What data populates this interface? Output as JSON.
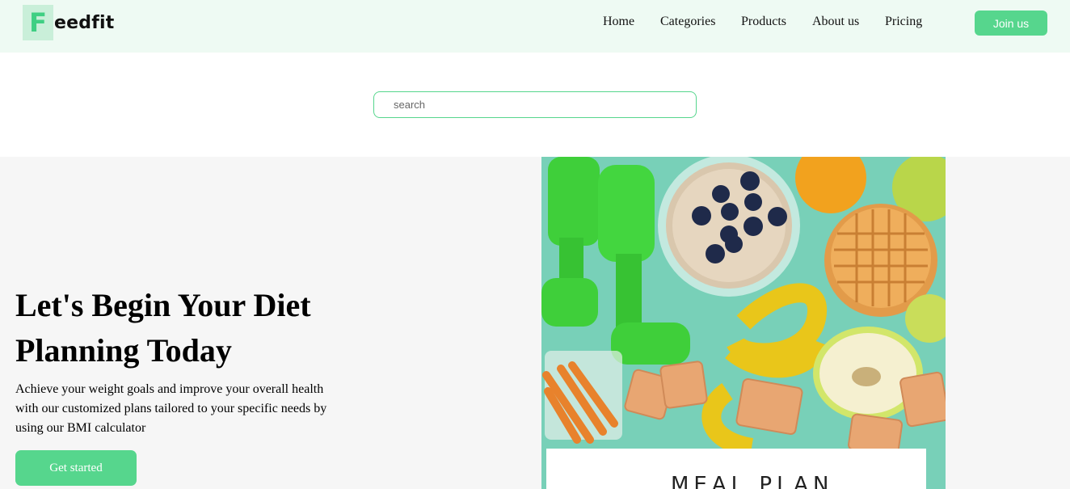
{
  "header": {
    "logo": {
      "letter": "F",
      "rest": "eedfit"
    },
    "nav": [
      {
        "label": "Home"
      },
      {
        "label": "Categories"
      },
      {
        "label": "Products"
      },
      {
        "label": "About us"
      },
      {
        "label": "Pricing"
      }
    ],
    "join_label": "Join us"
  },
  "search": {
    "placeholder": "search",
    "value": ""
  },
  "hero": {
    "title": "Let's Begin Your Diet Planning Today",
    "description": "Achieve your weight goals and improve your overall health with our customized plans tailored to your specific needs by using our BMI calculator",
    "cta_label": "Get started",
    "image": {
      "alt": "Healthy food with dumbbells and measuring tape",
      "note_text": "MEAL PLAN"
    }
  },
  "colors": {
    "accent": "#56d68d",
    "header_bg": "#eefaf3",
    "hero_bg": "#f6f6f6"
  }
}
